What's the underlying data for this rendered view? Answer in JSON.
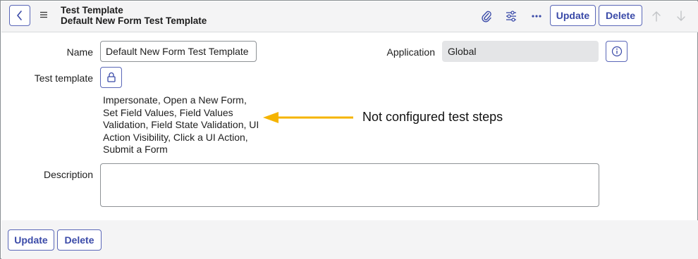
{
  "header": {
    "title": "Test Template",
    "subtitle": "Default New Form Test Template",
    "icons": [
      "back-icon",
      "menu-icon",
      "attachment-icon",
      "settings-sliders-icon",
      "more-icon",
      "arrow-up-icon",
      "arrow-down-icon"
    ],
    "update_label": "Update",
    "delete_label": "Delete"
  },
  "form": {
    "name_label": "Name",
    "name_value": "Default New Form Test Template",
    "application_label": "Application",
    "application_value": "Global",
    "test_template_label": "Test template",
    "test_steps": "Impersonate, Open a New Form, Set Field Values, Field Values Validation, Field State Validation, UI Action Visibility, Click a UI Action, Submit a Form",
    "description_label": "Description",
    "description_value": ""
  },
  "annotation": {
    "text": "Not configured test steps",
    "arrow_color": "#f5b400"
  },
  "footer": {
    "update_label": "Update",
    "delete_label": "Delete"
  },
  "colors": {
    "accent": "#3a4aa8",
    "header_bg": "#f4f4f5",
    "readonly_bg": "#e4e5e7"
  }
}
